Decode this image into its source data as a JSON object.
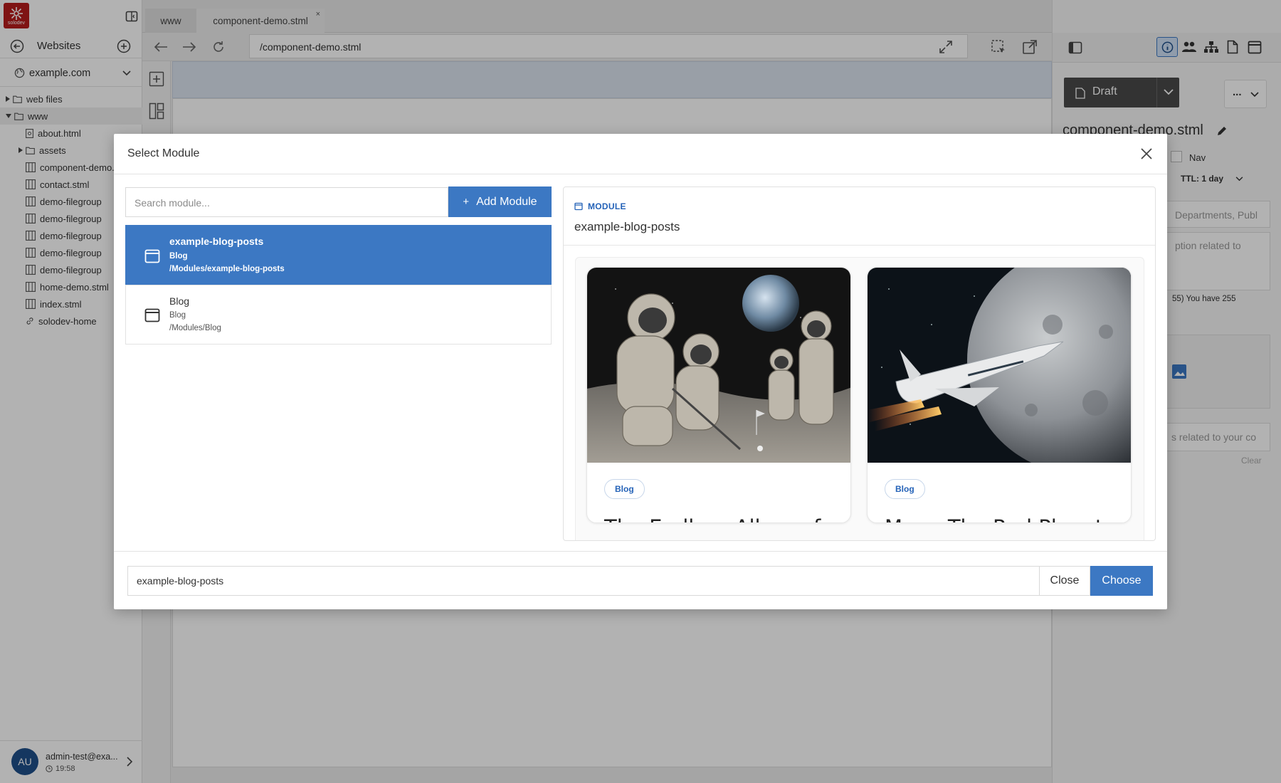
{
  "app": {
    "logo_text": "solodev",
    "brand_color": "#b71c1c",
    "accent": "#3c78c3"
  },
  "sidebar": {
    "title": "Websites",
    "site_select": "example.com",
    "tree": [
      {
        "label": "web files",
        "type": "folder",
        "depth": 0,
        "arrow": "right"
      },
      {
        "label": "www",
        "type": "folder",
        "depth": 0,
        "arrow": "down"
      },
      {
        "label": "about.html",
        "type": "file",
        "depth": 1
      },
      {
        "label": "assets",
        "type": "folder",
        "depth": 1,
        "arrow": "right"
      },
      {
        "label": "component-demo.stml",
        "type": "stml",
        "depth": 1
      },
      {
        "label": "contact.stml",
        "type": "stml",
        "depth": 1
      },
      {
        "label": "demo-filegroup",
        "type": "stml",
        "depth": 1
      },
      {
        "label": "demo-filegroup",
        "type": "stml",
        "depth": 1
      },
      {
        "label": "demo-filegroup",
        "type": "stml",
        "depth": 1
      },
      {
        "label": "demo-filegroup",
        "type": "stml",
        "depth": 1
      },
      {
        "label": "demo-filegroup",
        "type": "stml",
        "depth": 1
      },
      {
        "label": "home-demo.stml",
        "type": "stml",
        "depth": 1
      },
      {
        "label": "index.stml",
        "type": "stml",
        "depth": 1
      },
      {
        "label": "solodev-home",
        "type": "link",
        "depth": 1
      }
    ],
    "user": {
      "initials": "AU",
      "email": "admin-test@exa...",
      "time": "19:58"
    }
  },
  "tabs": [
    {
      "label": "www"
    },
    {
      "label": "component-demo.stml"
    }
  ],
  "address": {
    "url": "/component-demo.stml"
  },
  "right_panel": {
    "status_button": "Draft",
    "more": "...",
    "filename": "component-demo.stml",
    "nav_label": "Nav",
    "ttl": "TTL: 1 day",
    "departments_placeholder": "Departments, Publ",
    "description_placeholder": "ption related to",
    "char_count": "55) You have 255",
    "tags_placeholder": "s related to your co",
    "clear_label": "Clear"
  },
  "modal": {
    "title": "Select Module",
    "search_placeholder": "Search module...",
    "add_button": "Add Module",
    "add_plus": "+",
    "modules": [
      {
        "name": "example-blog-posts",
        "category": "Blog",
        "path": "/Modules/example-blog-posts",
        "selected": true
      },
      {
        "name": "Blog",
        "category": "Blog",
        "path": "/Modules/Blog",
        "selected": false
      }
    ],
    "preview": {
      "kicker": "MODULE",
      "name": "example-blog-posts",
      "cards": [
        {
          "tag": "Blog",
          "title": "The Endless Allure of",
          "image": "astronauts-golfing-on-moon"
        },
        {
          "tag": "Blog",
          "title": "Mars: The Red Planet",
          "image": "supersonic-jet-near-moon"
        }
      ]
    },
    "selected_value": "example-blog-posts",
    "close_button": "Close",
    "choose_button": "Choose"
  }
}
